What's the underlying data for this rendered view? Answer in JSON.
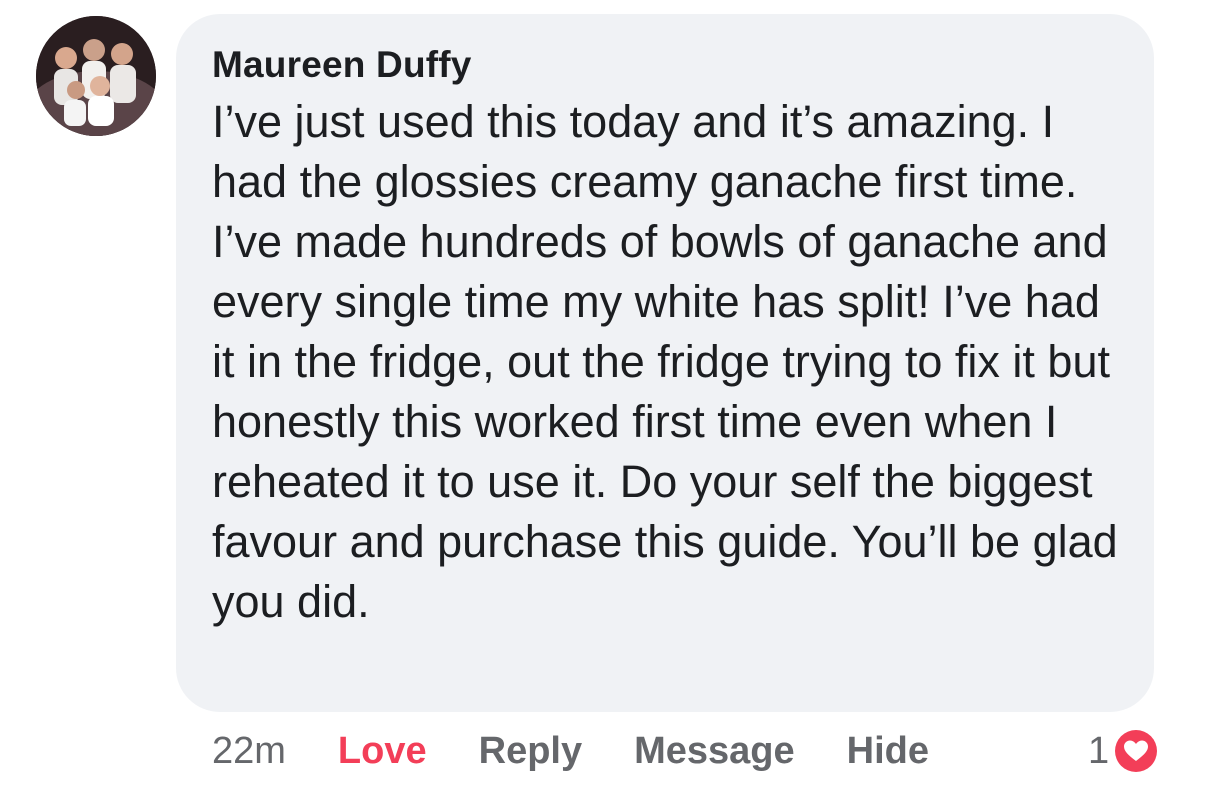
{
  "comment": {
    "author": "Maureen Duffy",
    "text": "I’ve just used this today and it’s amazing. I had the glossies creamy ganache first time. I’ve made hundreds of bowls of ganache and every single time my white has split! I’ve had it in the fridge, out the fridge trying to fix it but honestly this worked first time even when I reheated it to use it. Do your self the biggest favour and purchase this guide. You’ll be glad you did.",
    "avatar_icon": "profile-photo",
    "bubble_color": "#f0f2f5"
  },
  "actions": {
    "time": "22m",
    "love": "Love",
    "reply": "Reply",
    "message": "Message",
    "hide": "Hide"
  },
  "reactions": {
    "count": "1",
    "icon": "heart-icon",
    "color": "#f33e58"
  }
}
